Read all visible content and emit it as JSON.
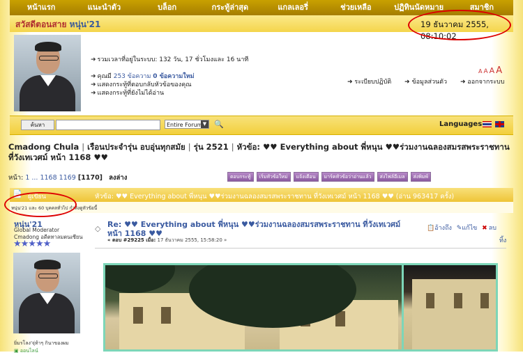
{
  "nav": {
    "items": [
      "หน้าแรก",
      "แนะนำตัว",
      "บล็อก",
      "กระทู้ล่าสุด",
      "แกลเลอรี่",
      "ช่วยเหลือ",
      "ปฏิทินนัดหมาย",
      "สมาชิก"
    ]
  },
  "greeting": {
    "prefix": "สวัสดีตอนสาย",
    "user": "หนุ่น'21"
  },
  "clock": "19 ธันวาคม 2555, 08:10:02",
  "user_panel": {
    "online_time_label": "รวมเวลาที่อยู่ในระบบ:",
    "online_time": "132 วัน, 17 ชั่วโมงและ 16 นาที",
    "you_have": "คุณมี",
    "messages_count": "253",
    "messages_word": "ข้อความ",
    "new_count": "0 ข้อความใหม่",
    "link_replies": "แสดงกระทู้ที่ตอบกลับหัวข้อของคุณ",
    "link_unread": "แสดงกระทู้ที่ยังไม่ได้อ่าน",
    "link_rules": "ระเบียบปฏิบัติ",
    "link_profile": "ข้อมูลส่วนตัว",
    "link_logout": "ออกจากระบบ",
    "font_sizes": [
      "A",
      "A",
      "A",
      "A"
    ]
  },
  "search": {
    "button": "ค้นหา",
    "scope": "Entire Forum",
    "languages": "Languages"
  },
  "breadcrumb": [
    "Cmadong Chula",
    "เรือนประจำรุ่น อบอุ่นทุกสมัย",
    "รุ่น 2521",
    "หัวข้อ: ♥♥ Everything about พี่หนุน ♥♥ร่วมงานฉลองสมรสพระราชทาน ที่วังเทเวศม์ หน้า 1168 ♥♥"
  ],
  "pages": {
    "label": "หน้า:",
    "list": "1 ... 1168 1169",
    "current": "[1170]",
    "down": "ลงล่าง"
  },
  "toolbar": [
    "ตอบกระทู้",
    "เริ่มหัวข้อใหม่",
    "แจ้งเตือน",
    "มาร์คหัวข้อว่าอ่านแล้ว",
    "ส่งไฟล์อีเมล",
    "ส่งพิมพ์"
  ],
  "topic": {
    "author_label": "ผู้เขียน",
    "title": "หัวข้อ: ♥♥ Everything about พี่หนุน ♥♥ร่วมงานฉลองสมรสพระราชทาน ที่วังเทเวศม์ หน้า 1168 ♥♥  (อ่าน 963417 ครั้ง)",
    "viewers": "หนุ่น'21 และ 60 บุคคลทั่วไป กำลังดูหัวข้อนี้"
  },
  "post": {
    "author": "หนุ่น'21",
    "rank": "Global Moderator",
    "group": "Cmadong อดีตทาลมตนเซียน",
    "stars": "★★★★★",
    "title": "Re: ♥♥ Everything about พี่หนุน ♥♥ร่วมงานฉลองสมรสพระราชทาน ที่วังเทเวศม์ หน้า 1168 ♥♥",
    "meta_prefix": "« ตอบ #29225 เมื่อ:",
    "meta_date": "17 ธันวาคม 2555, 15:58:20 »",
    "quote": "อ้างถึง",
    "edit": "แก้ไข",
    "delete": "ลบ",
    "delete2": "ทิ้ง",
    "signature": "ยิ่มรโลง'จุ่ท้าๆ กินาของผม",
    "online": "ออนไลน์"
  }
}
